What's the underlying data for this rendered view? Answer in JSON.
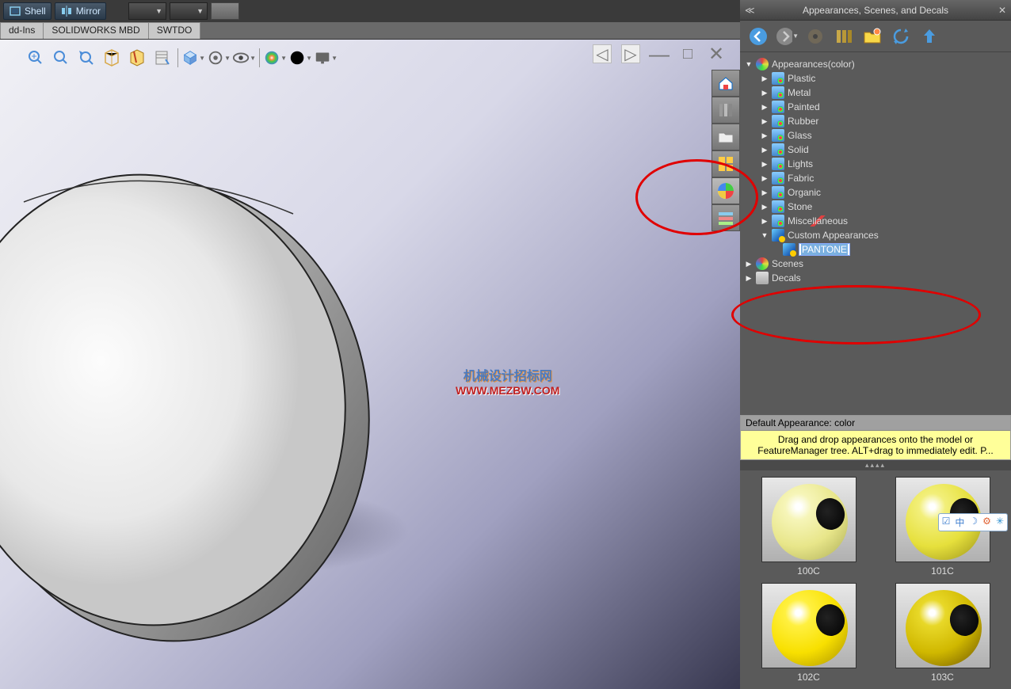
{
  "topbar": {
    "shell": "Shell",
    "mirror": "Mirror"
  },
  "tabs": [
    "dd-Ins",
    "SOLIDWORKS MBD",
    "SWTDO"
  ],
  "watermark": {
    "line1": "机械设计招标网",
    "line2": "WWW.MEZBW.COM"
  },
  "taskpane": {
    "title": "Appearances, Scenes, and Decals",
    "tree": {
      "root": "Appearances(color)",
      "children": [
        "Plastic",
        "Metal",
        "Painted",
        "Rubber",
        "Glass",
        "Solid",
        "Lights",
        "Fabric",
        "Organic",
        "Stone",
        "Miscellaneous"
      ],
      "custom": "Custom Appearances",
      "custom_child": "PANTONE",
      "scenes": "Scenes",
      "decals": "Decals"
    },
    "default_header": "Default Appearance: color",
    "default_body": "Drag and drop appearances onto the model or FeatureManager tree.  ALT+drag to immediately edit.  P...",
    "swatches": [
      {
        "id": "c100",
        "label": "100C"
      },
      {
        "id": "c101",
        "label": "101C"
      },
      {
        "id": "c102",
        "label": "102C"
      },
      {
        "id": "c103",
        "label": "103C"
      }
    ]
  },
  "float": [
    "☑",
    "中",
    "☽",
    "⚙",
    "✳"
  ]
}
